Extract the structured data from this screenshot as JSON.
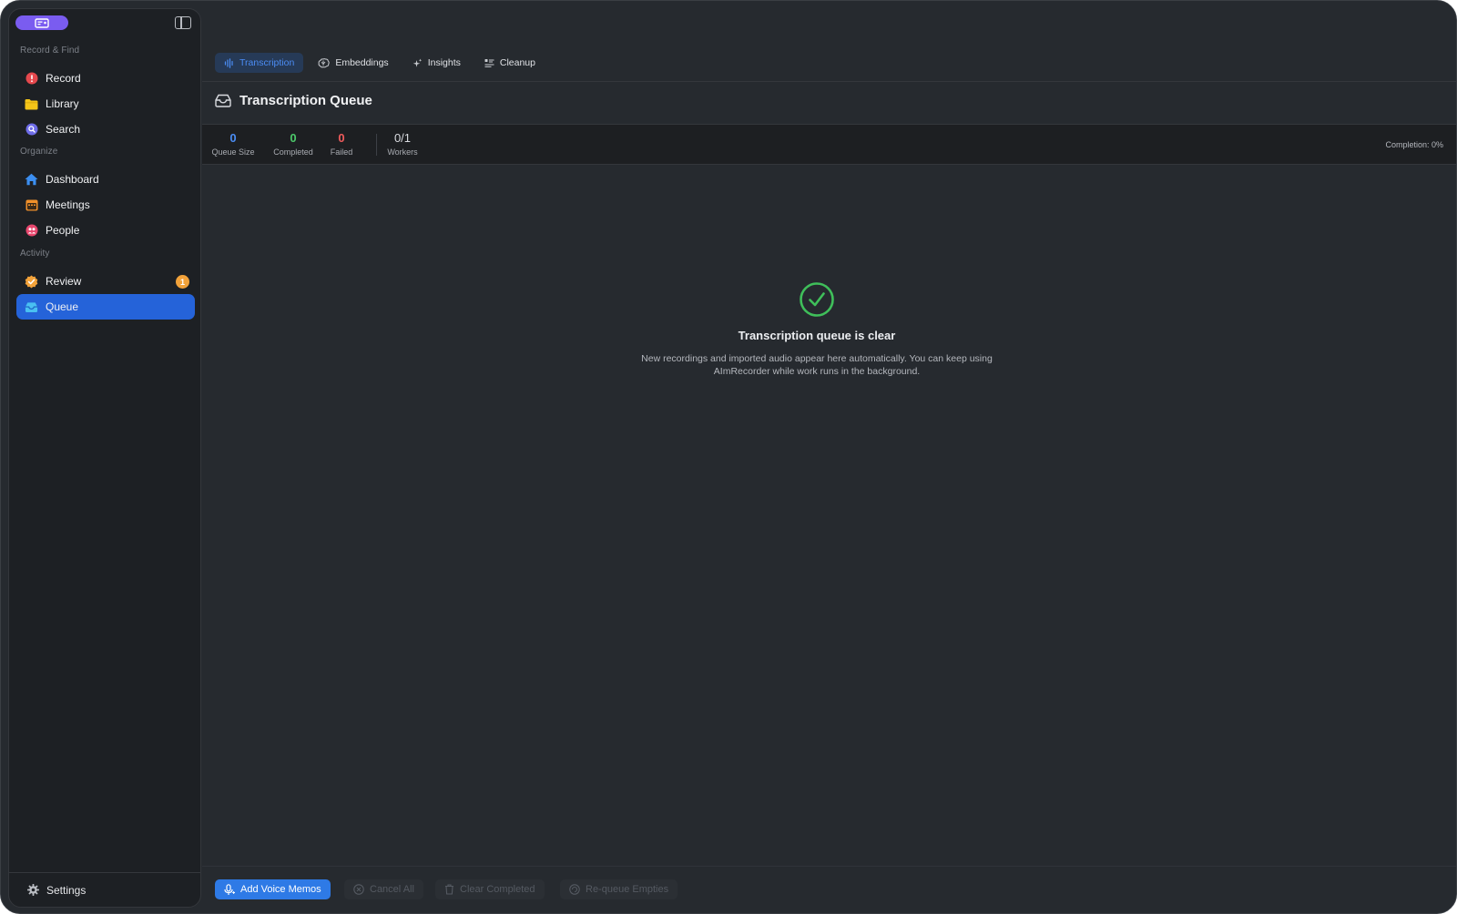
{
  "sidebar": {
    "sections": {
      "record_find": "Record & Find",
      "organize": "Organize",
      "activity": "Activity"
    },
    "items": {
      "record": {
        "label": "Record",
        "icon": "record-icon",
        "color": "#e5484d"
      },
      "library": {
        "label": "Library",
        "icon": "folder-icon",
        "color": "#f5c518"
      },
      "search": {
        "label": "Search",
        "icon": "search-icon",
        "color": "#6e6ce8"
      },
      "dashboard": {
        "label": "Dashboard",
        "icon": "home-icon",
        "color": "#3b8ef0"
      },
      "meetings": {
        "label": "Meetings",
        "icon": "calendar-icon",
        "color": "#f0902a"
      },
      "people": {
        "label": "People",
        "icon": "people-icon",
        "color": "#e8476e"
      },
      "review": {
        "label": "Review",
        "icon": "verified-badge-icon",
        "color": "#f2a23a",
        "badge": "1"
      },
      "queue": {
        "label": "Queue",
        "icon": "tray-icon",
        "color": "#49c0f2",
        "active": true
      }
    },
    "settings_label": "Settings"
  },
  "tabs": [
    {
      "label": "Transcription",
      "icon": "waveform-icon",
      "active": true
    },
    {
      "label": "Embeddings",
      "icon": "brain-icon"
    },
    {
      "label": "Insights",
      "icon": "sparkles-icon"
    },
    {
      "label": "Cleanup",
      "icon": "list-clean-icon"
    }
  ],
  "queue": {
    "title": "Transcription Queue",
    "stats": {
      "queue_size": {
        "value": "0",
        "label": "Queue Size",
        "color": "#4b8df5"
      },
      "completed": {
        "value": "0",
        "label": "Completed",
        "color": "#4cc96a"
      },
      "failed": {
        "value": "0",
        "label": "Failed",
        "color": "#ef5b5b"
      },
      "workers": {
        "value": "0/1",
        "label": "Workers",
        "color": "#d9dbe0"
      }
    },
    "completion": "Completion: 0%"
  },
  "empty_state": {
    "title": "Transcription queue is clear",
    "subtitle": "New recordings and imported audio appear here automatically. You can keep using AImRecorder while work runs in the background.",
    "icon": "checkmark-circle-icon",
    "color": "#3fbf5a"
  },
  "footer": {
    "add_voice_memos": "Add Voice Memos",
    "cancel_all": "Cancel All",
    "clear_completed": "Clear Completed",
    "requeue_empties": "Re-queue Empties"
  }
}
